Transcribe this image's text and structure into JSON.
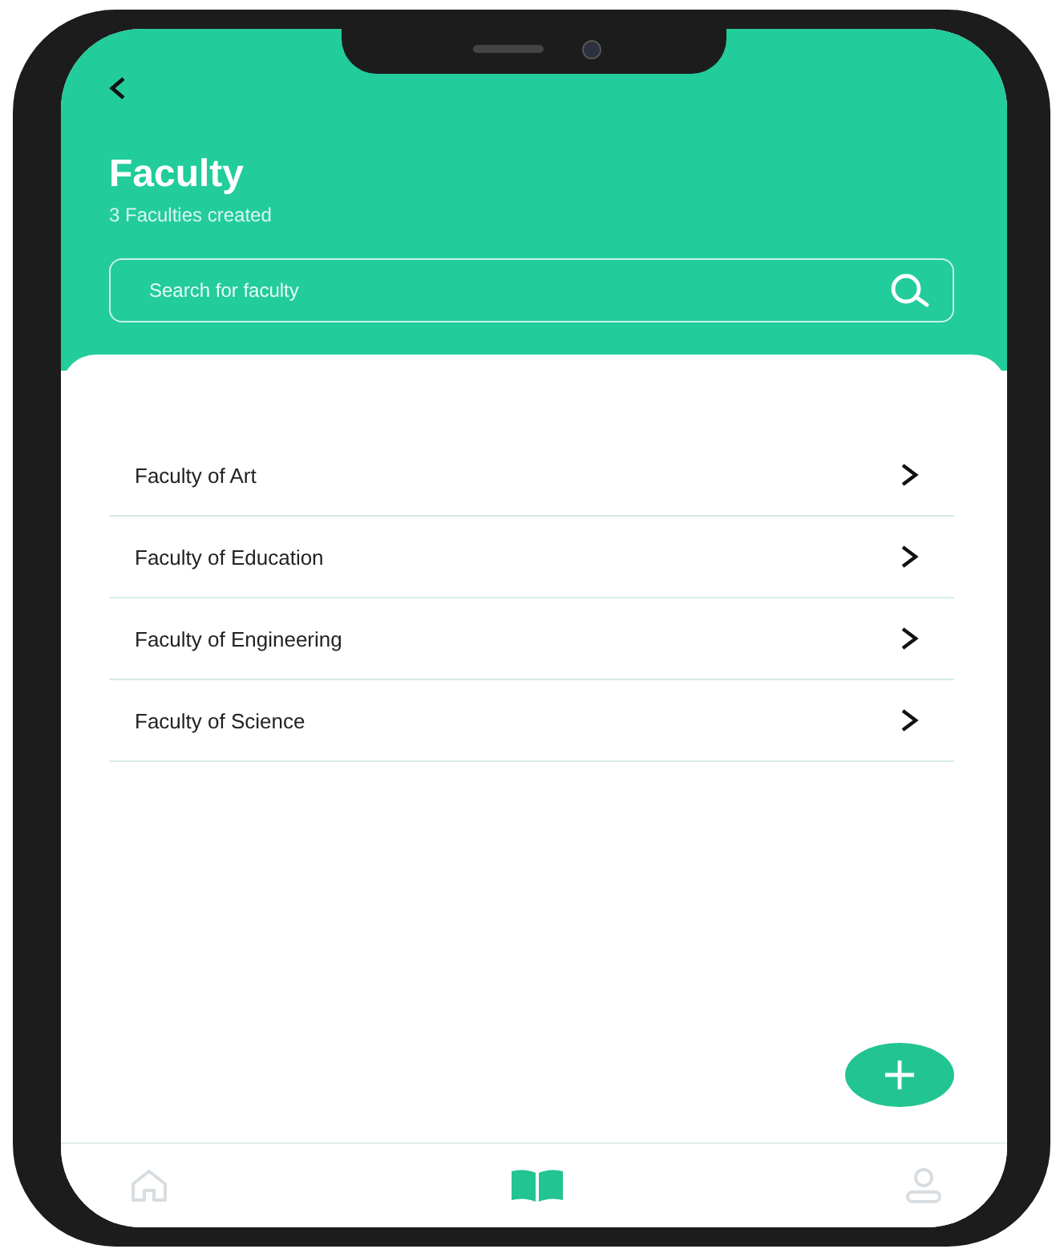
{
  "header": {
    "title": "Faculty",
    "subtitle": "3 Faculties created"
  },
  "search": {
    "placeholder": "Search for faculty"
  },
  "faculties": [
    {
      "name": "Faculty of Art"
    },
    {
      "name": "Faculty of Education"
    },
    {
      "name": "Faculty of Engineering"
    },
    {
      "name": "Faculty of Science"
    }
  ],
  "bottom_nav": [
    {
      "kind": "home",
      "selected": false
    },
    {
      "kind": "book",
      "selected": true
    },
    {
      "kind": "profile",
      "selected": false
    }
  ]
}
